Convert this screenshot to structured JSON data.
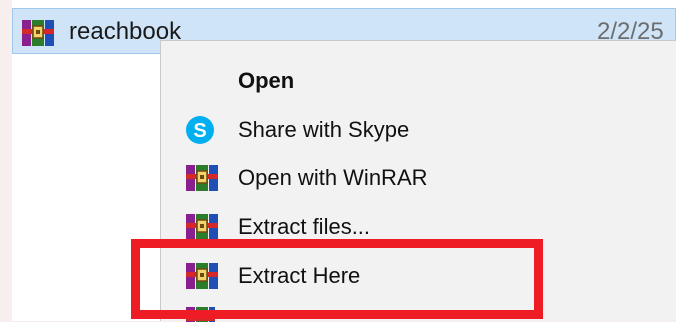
{
  "file": {
    "name": "reachbook",
    "date": "2/2/25"
  },
  "context_menu": {
    "items": [
      {
        "label": "Open",
        "icon": null
      },
      {
        "label": "Share with Skype",
        "icon": "skype-icon"
      },
      {
        "label": "Open with WinRAR",
        "icon": "winrar-icon"
      },
      {
        "label": "Extract files...",
        "icon": "winrar-icon"
      },
      {
        "label": "Extract Here",
        "icon": "winrar-icon"
      }
    ]
  },
  "colors": {
    "selection": "#cfe5f7",
    "menu_background": "#f2f2f2",
    "highlight_annotation": "#ee1c25",
    "skype_blue": "#00aff0"
  }
}
